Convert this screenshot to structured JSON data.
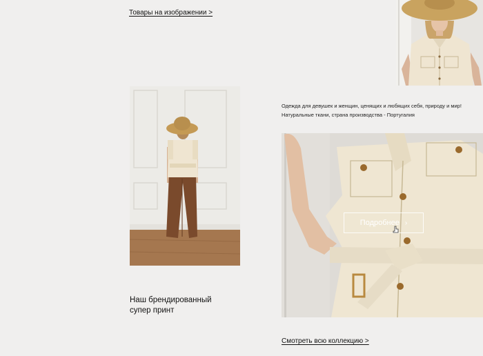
{
  "links": {
    "products_in_image": "Товары на изображении >",
    "view_collection": "Смотреть всю коллекцию >"
  },
  "description": "Одежда для девушек и женщин, ценящих и любящих себя, природу и мир! Натуральные ткани, страна производства - Португалия",
  "brand_heading": "Наш брендированный супер принт",
  "hero_button": {
    "label": "Подробнее",
    "icon": "chevron-right-icon"
  },
  "colors": {
    "background": "#f0efee",
    "linen": "#efe5d1",
    "brown_trousers": "#7a4a2c",
    "floor": "#a5774f"
  }
}
